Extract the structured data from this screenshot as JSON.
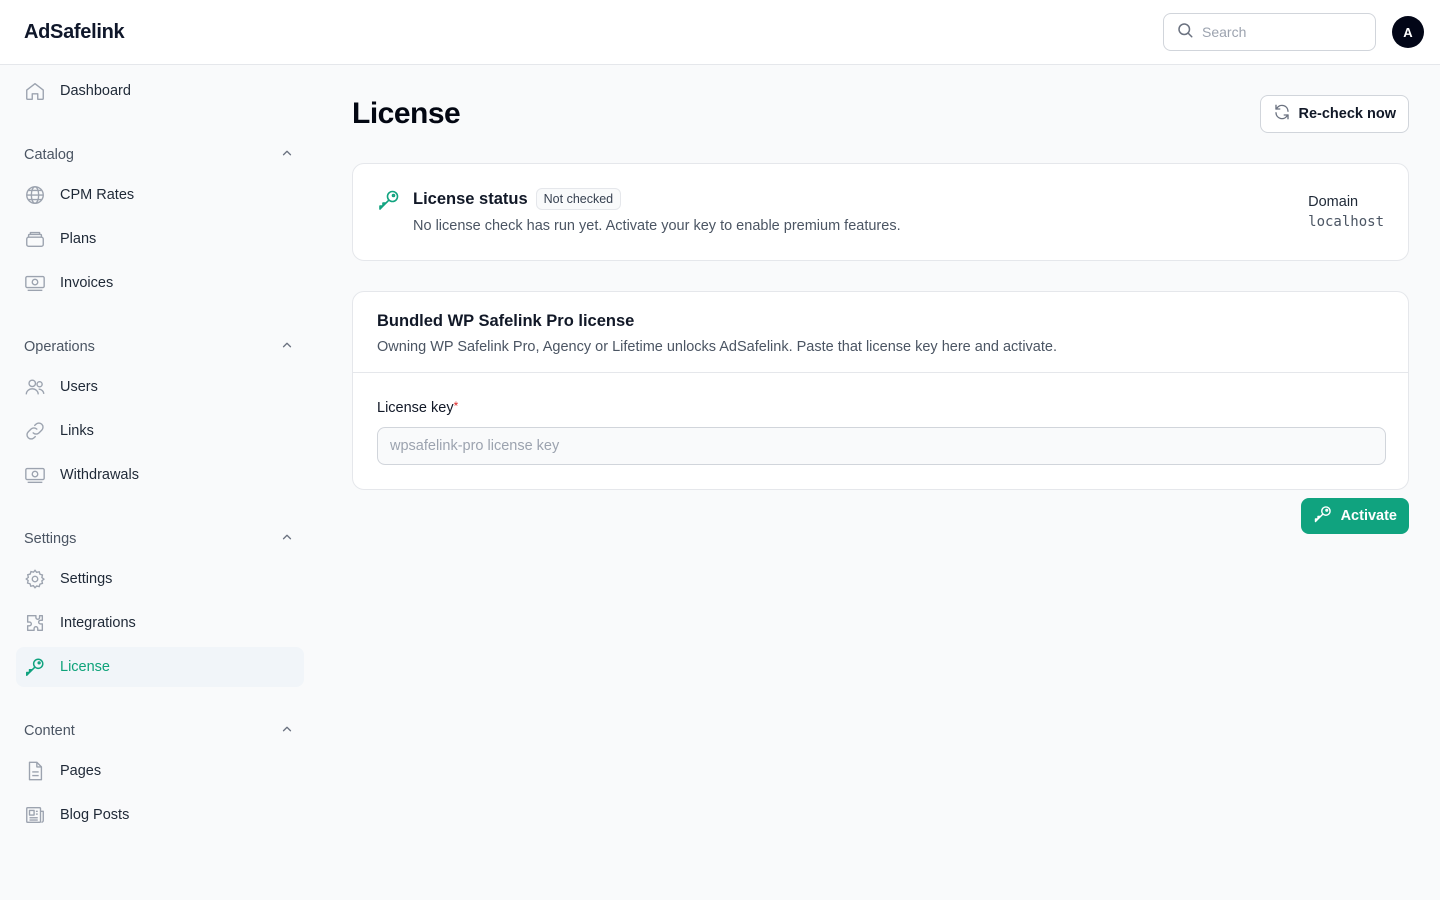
{
  "app": {
    "brand": "AdSafelink"
  },
  "header": {
    "search_placeholder": "Search",
    "avatar_initial": "A"
  },
  "sidebar": {
    "dashboard": "Dashboard",
    "groups": {
      "catalog": "Catalog",
      "operations": "Operations",
      "settings": "Settings",
      "content": "Content"
    },
    "items": {
      "cpm_rates": "CPM Rates",
      "plans": "Plans",
      "invoices": "Invoices",
      "users": "Users",
      "links": "Links",
      "withdrawals": "Withdrawals",
      "settings": "Settings",
      "integrations": "Integrations",
      "license": "License",
      "pages": "Pages",
      "blog_posts": "Blog Posts"
    },
    "active": "license"
  },
  "main": {
    "title": "License",
    "recheck_label": "Re-check now",
    "status": {
      "title": "License status",
      "badge": "Not checked",
      "description": "No license check has run yet. Activate your key to enable premium features.",
      "domain_label": "Domain",
      "domain_value": "localhost"
    },
    "bundle": {
      "title": "Bundled WP Safelink Pro license",
      "description": "Owning WP Safelink Pro, Agency or Lifetime unlocks AdSafelink. Paste that license key here and activate.",
      "field_label": "License key",
      "required_mark": "*",
      "placeholder": "wpsafelink-pro license key",
      "value": ""
    },
    "activate_label": "Activate"
  },
  "colors": {
    "accent": "#10a37f",
    "active_text": "#0ea37a",
    "required": "#dc2626"
  }
}
